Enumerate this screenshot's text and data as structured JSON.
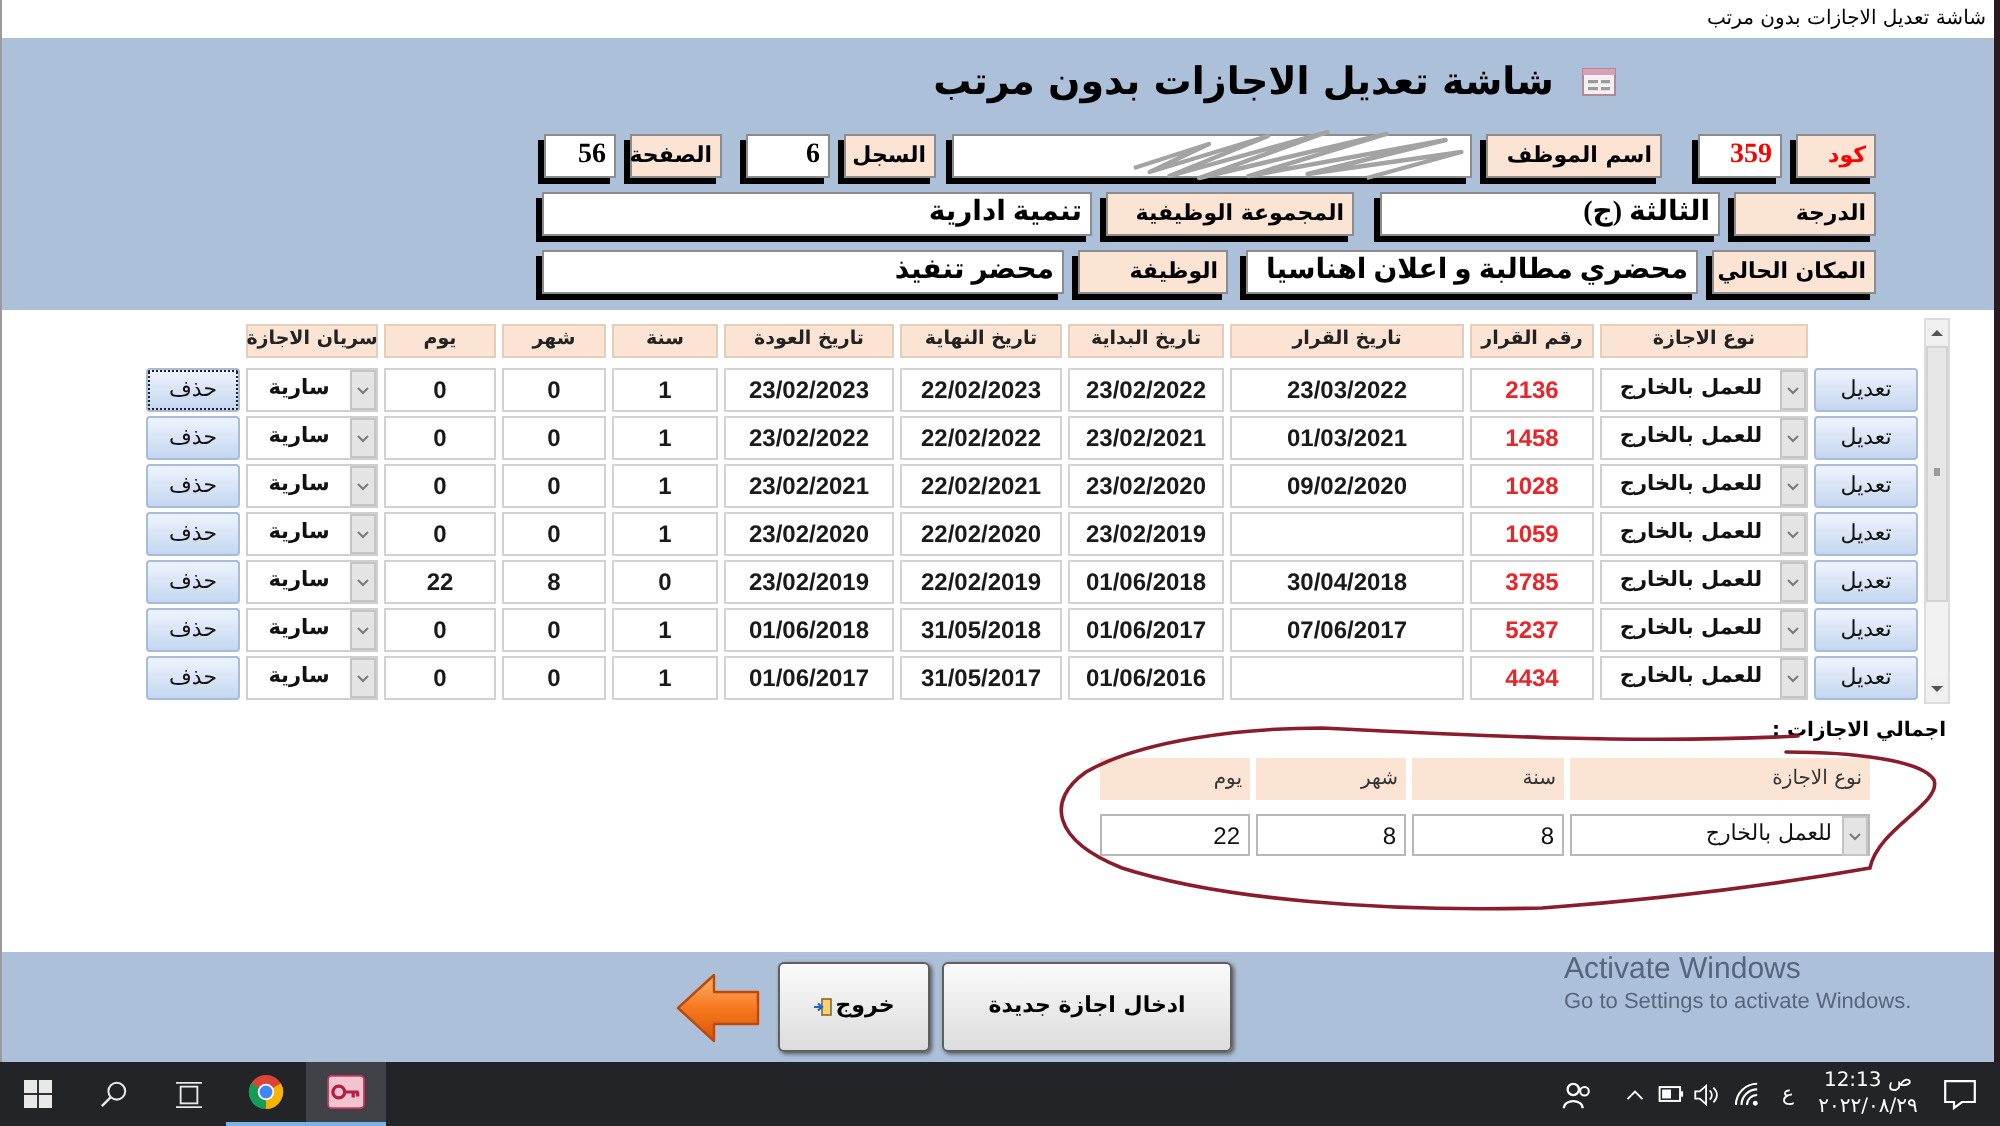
{
  "window": {
    "title": "شاشة تعديل الاجازات بدون مرتب"
  },
  "form": {
    "title": "شاشة تعديل الاجازات بدون مرتب",
    "field_rows": [
      [
        {
          "label": "كود",
          "value": "359",
          "highlight": true,
          "redacted": false
        },
        {
          "label": "اسم الموظف",
          "highlight": false,
          "redacted": true
        },
        {
          "label": "السجل",
          "value": "6",
          "highlight": false,
          "redacted": false
        },
        {
          "label": "الصفحة",
          "value": "56",
          "highlight": false,
          "redacted": false
        }
      ],
      [
        {
          "label": "الدرجة",
          "value": "الثالثة (ج)",
          "highlight": false,
          "redacted": false
        },
        {
          "label": "المجموعة الوظيفية",
          "value": "تنمية ادارية",
          "highlight": false,
          "redacted": false
        }
      ],
      [
        {
          "label": "المكان الحالي",
          "value": "محضري مطالبة و اعلان اهناسيا",
          "highlight": false,
          "redacted": false
        },
        {
          "label": "الوظيفة",
          "value": "محضر تنفيذ",
          "highlight": false,
          "redacted": false
        }
      ]
    ]
  },
  "leaves_table": {
    "columns": [
      {
        "label": "نوع الاجازة",
        "kind": "combo"
      },
      {
        "label": "رقم القرار",
        "kind": "number"
      },
      {
        "label": "تاريخ القرار",
        "kind": "text"
      },
      {
        "label": "تاريخ البداية",
        "kind": "text"
      },
      {
        "label": "تاريخ النهاية",
        "kind": "text"
      },
      {
        "label": "تاريخ العودة",
        "kind": "text"
      },
      {
        "label": "سنة",
        "kind": "text"
      },
      {
        "label": "شهر",
        "kind": "text"
      },
      {
        "label": "يوم",
        "kind": "text"
      },
      {
        "label": "سريان الاجازة",
        "kind": "combo"
      }
    ],
    "rows": [
      {
        "edit_button": "تعديل",
        "cells": [
          "للعمل بالخارج",
          "2136",
          "23/03/2022",
          "23/02/2022",
          "22/02/2023",
          "23/02/2023",
          "1",
          "0",
          "0",
          "سارية"
        ],
        "delete_button": "حذف",
        "focused": true
      },
      {
        "edit_button": "تعديل",
        "cells": [
          "للعمل بالخارج",
          "1458",
          "01/03/2021",
          "23/02/2021",
          "22/02/2022",
          "23/02/2022",
          "1",
          "0",
          "0",
          "سارية"
        ],
        "delete_button": "حذف",
        "focused": false
      },
      {
        "edit_button": "تعديل",
        "cells": [
          "للعمل بالخارج",
          "1028",
          "09/02/2020",
          "23/02/2020",
          "22/02/2021",
          "23/02/2021",
          "1",
          "0",
          "0",
          "سارية"
        ],
        "delete_button": "حذف",
        "focused": false
      },
      {
        "edit_button": "تعديل",
        "cells": [
          "للعمل بالخارج",
          "1059",
          null,
          "23/02/2019",
          "22/02/2020",
          "23/02/2020",
          "1",
          "0",
          "0",
          "سارية"
        ],
        "delete_button": "حذف",
        "focused": false
      },
      {
        "edit_button": "تعديل",
        "cells": [
          "للعمل بالخارج",
          "3785",
          "30/04/2018",
          "01/06/2018",
          "22/02/2019",
          "23/02/2019",
          "0",
          "8",
          "22",
          "سارية"
        ],
        "delete_button": "حذف",
        "focused": false
      },
      {
        "edit_button": "تعديل",
        "cells": [
          "للعمل بالخارج",
          "5237",
          "07/06/2017",
          "01/06/2017",
          "31/05/2018",
          "01/06/2018",
          "1",
          "0",
          "0",
          "سارية"
        ],
        "delete_button": "حذف",
        "focused": false
      },
      {
        "edit_button": "تعديل",
        "cells": [
          "للعمل بالخارج",
          "4434",
          null,
          "01/06/2016",
          "31/05/2017",
          "01/06/2017",
          "1",
          "0",
          "0",
          "سارية"
        ],
        "delete_button": "حذف",
        "focused": false
      }
    ]
  },
  "totals": {
    "title": "اجمالي الاجازات :",
    "columns": [
      {
        "label": "نوع الاجازة",
        "kind": "combo"
      },
      {
        "label": "سنة",
        "kind": "text"
      },
      {
        "label": "شهر",
        "kind": "text"
      },
      {
        "label": "يوم",
        "kind": "text"
      }
    ],
    "values": [
      "للعمل بالخارج",
      "8",
      "8",
      "22"
    ]
  },
  "footer_buttons": [
    {
      "label": "ادخال اجازة جديدة",
      "kind": "plain"
    },
    {
      "label": "خروج",
      "kind": "exit"
    }
  ],
  "activation_notice": {
    "title": "Activate Windows",
    "text": "Go to Settings to activate Windows."
  },
  "taskbar": {
    "apps": [
      {
        "kind": "browser",
        "active": false
      },
      {
        "kind": "database",
        "active": true
      }
    ],
    "language": "ع",
    "time": "12:13 ص",
    "date": "٢٠٢٢/٠٨/٢٩"
  }
}
